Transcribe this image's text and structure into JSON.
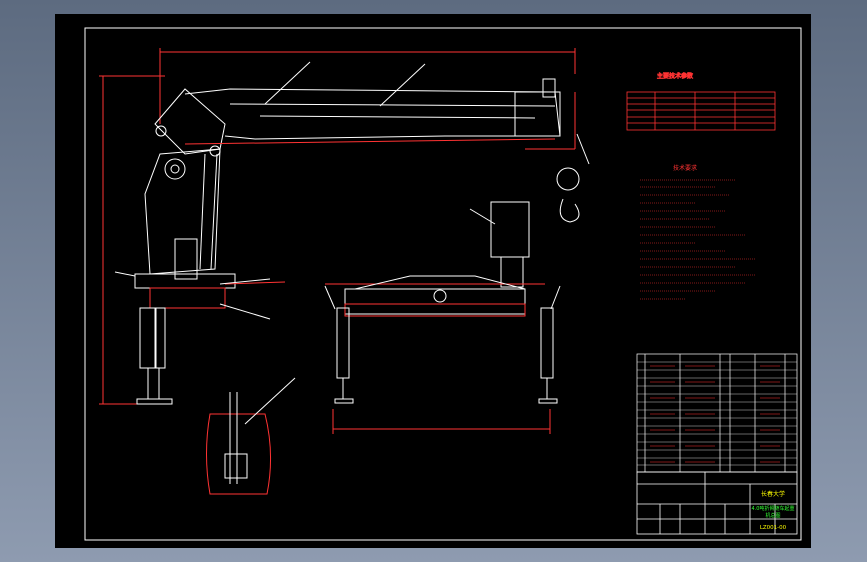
{
  "title_block": {
    "school": "长春大学",
    "drawing_title_line1": "4.0吨折臂随车起重",
    "drawing_title_line2": "机总图",
    "drawing_number": "LZ001-00"
  },
  "technical_requirements": {
    "heading": "技术要求"
  },
  "spec_table": {
    "heading": "主要技术参数"
  },
  "colors": {
    "background": "#000000",
    "frame": "#ffffff",
    "geometry": "#ffffff",
    "dimension": "#ff0000",
    "text": "#ff3333",
    "title_text": "#ffff00",
    "title_green": "#33ff33"
  }
}
